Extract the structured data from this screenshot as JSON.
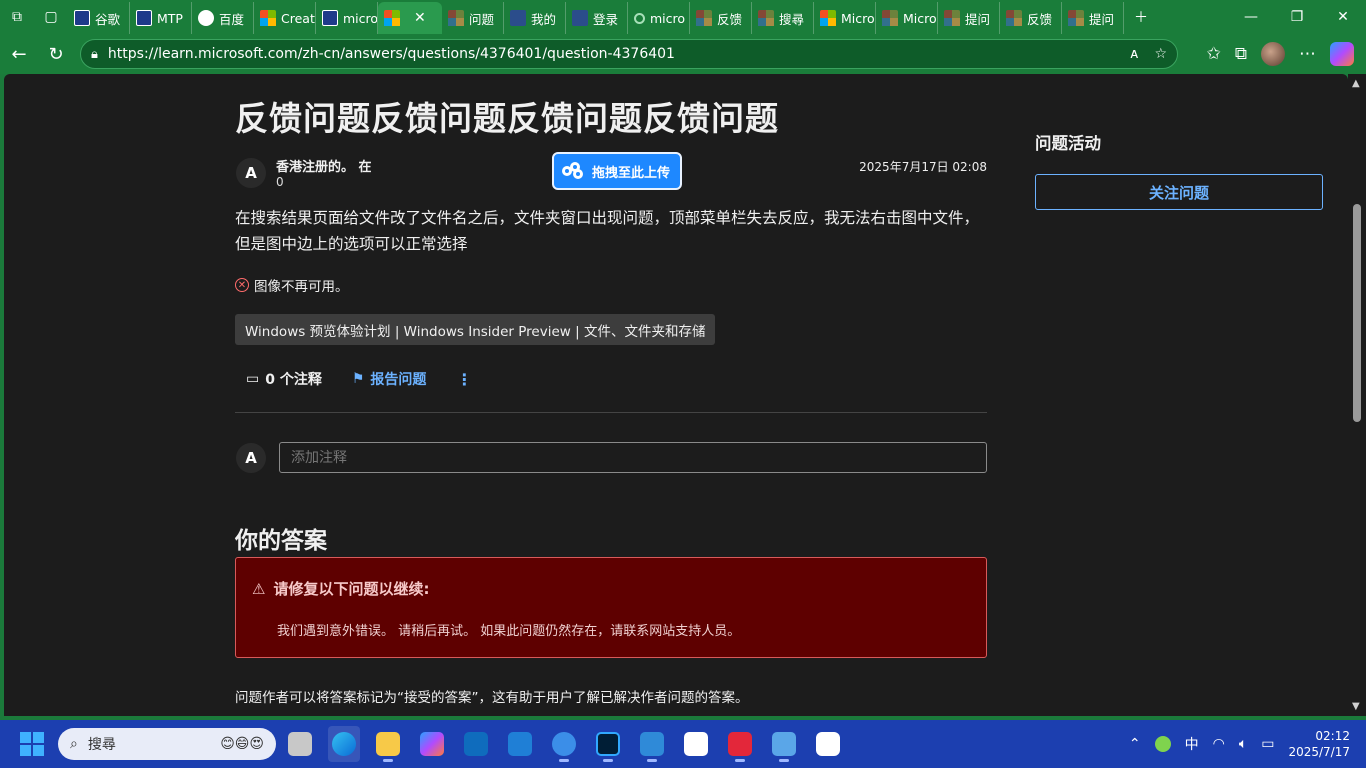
{
  "browser": {
    "tabs": [
      {
        "label": "谷歌",
        "icon": "paw-icon"
      },
      {
        "label": "MTP",
        "icon": "paw-icon"
      },
      {
        "label": "百度",
        "icon": "cloud-icon"
      },
      {
        "label": "Creat",
        "icon": "microsoft-icon"
      },
      {
        "label": "micro",
        "icon": "paw-icon"
      },
      {
        "label": "",
        "icon": "microsoft-icon",
        "active": true
      },
      {
        "label": "问题",
        "icon": "microsoft-icon"
      },
      {
        "label": "我的",
        "icon": "translate-icon"
      },
      {
        "label": "登录",
        "icon": "translate-icon"
      },
      {
        "label": "micro",
        "icon": "search-icon"
      },
      {
        "label": "反馈",
        "icon": "microsoft-icon"
      },
      {
        "label": "搜尋",
        "icon": "microsoft-icon"
      },
      {
        "label": "Micro",
        "icon": "microsoft-icon"
      },
      {
        "label": "Micro",
        "icon": "microsoft-icon"
      },
      {
        "label": "提问",
        "icon": "microsoft-icon"
      },
      {
        "label": "反馈",
        "icon": "microsoft-icon"
      },
      {
        "label": "提问",
        "icon": "microsoft-icon"
      }
    ],
    "url": "https://learn.microsoft.com/zh-cn/answers/questions/4376401/question-4376401"
  },
  "question": {
    "title": "反馈问题反馈问题反馈问题反馈问题",
    "author_initial": "A",
    "author_name": "香港注册的。 在",
    "author_rep": "0",
    "date": "2025年7月17日 02:08",
    "body": "在搜索结果页面给文件改了文件名之后，文件夹窗口出现问题，顶部菜单栏失去反应，我无法右击图中文件，但是图中边上的选项可以正常选择",
    "image_missing": "图像不再可用。",
    "tag": "Windows 预览体验计划 | Windows Insider Preview | 文件、文件夹和存储",
    "comments_label": "0 个注释",
    "report_label": "报告问题"
  },
  "upload_overlay": {
    "label": "拖拽至此上传"
  },
  "comment": {
    "initial": "A",
    "placeholder": "添加注释"
  },
  "answers": {
    "heading": "你的答案",
    "error_title": "请修复以下问题以继续:",
    "error_message": "我们遇到意外错误。 请稍后再试。 如果此问题仍然存在，请联系网站支持人员。",
    "hint": "问题作者可以将答案标记为“接受的答案”，这有助于用户了解已解决作者问题的答案。"
  },
  "sidebar": {
    "heading": "问题活动",
    "follow_label": "关注问题"
  },
  "taskbar": {
    "search_placeholder": "搜尋",
    "ime": "中",
    "time": "02:12",
    "date": "2025/7/17"
  },
  "colors": {
    "tabbar": "#1a7d3a",
    "page_bg": "#1c1c1c",
    "link": "#6cb2ff",
    "error_bg": "#5e0000",
    "taskbar": "#1c3fb0"
  }
}
